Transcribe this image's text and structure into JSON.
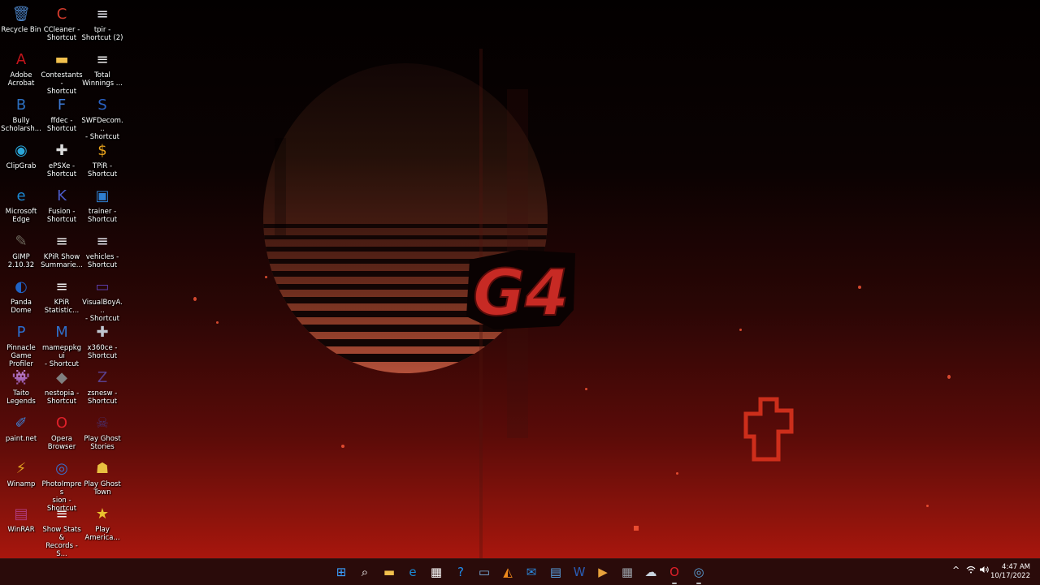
{
  "desktop": {
    "icons": [
      {
        "label": "Recycle Bin",
        "icon": "recycle-bin-icon",
        "glyph": "🗑",
        "color": "#4a7fc0"
      },
      {
        "label": "CCleaner -\nShortcut",
        "icon": "ccleaner-icon",
        "glyph": "C",
        "color": "#d33a2c"
      },
      {
        "label": "tpir -\nShortcut (2)",
        "icon": "document-icon",
        "glyph": "≡",
        "color": "#e8e8f0"
      },
      {
        "label": "Adobe\nAcrobat",
        "icon": "adobe-acrobat-icon",
        "glyph": "A",
        "color": "#c4141b"
      },
      {
        "label": "Contestants -\nShortcut",
        "icon": "folder-icon",
        "glyph": "▬",
        "color": "#f2c14e"
      },
      {
        "label": "Total\nWinnings ...",
        "icon": "text-file-icon",
        "glyph": "≡",
        "color": "#f0f0f0"
      },
      {
        "label": "Bully\nScholarsh...",
        "icon": "bully-game-icon",
        "glyph": "B",
        "color": "#2c6fbf"
      },
      {
        "label": "ffdec -\nShortcut",
        "icon": "ffdec-icon",
        "glyph": "F",
        "color": "#3d7ad6"
      },
      {
        "label": "SWFDecom...\n- Shortcut",
        "icon": "swf-decompiler-icon",
        "glyph": "S",
        "color": "#2a62c4"
      },
      {
        "label": "ClipGrab",
        "icon": "clipgrab-icon",
        "glyph": "◉",
        "color": "#2aa6d9"
      },
      {
        "label": "ePSXe -\nShortcut",
        "icon": "gamepad-icon",
        "glyph": "✚",
        "color": "#dcdcdc"
      },
      {
        "label": "TPiR -\nShortcut",
        "icon": "tpir-game-icon",
        "glyph": "$",
        "color": "#e8a21c"
      },
      {
        "label": "Microsoft\nEdge",
        "icon": "edge-icon",
        "glyph": "e",
        "color": "#1b8ad4"
      },
      {
        "label": "Fusion -\nShortcut",
        "icon": "fusion-emulator-icon",
        "glyph": "K",
        "color": "#4b5bc8"
      },
      {
        "label": "trainer -\nShortcut",
        "icon": "trainer-icon",
        "glyph": "▣",
        "color": "#2f7fd0"
      },
      {
        "label": "GIMP 2.10.32",
        "icon": "gimp-icon",
        "glyph": "✎",
        "color": "#6e6a5e"
      },
      {
        "label": "KPiR Show\nSummarie...",
        "icon": "text-file-icon",
        "glyph": "≡",
        "color": "#f0f0f0"
      },
      {
        "label": "vehicles -\nShortcut",
        "icon": "document-icon",
        "glyph": "≡",
        "color": "#e8e8f0"
      },
      {
        "label": "Panda Dome",
        "icon": "panda-dome-icon",
        "glyph": "◐",
        "color": "#1f63c6"
      },
      {
        "label": "KPiR\nStatistic...",
        "icon": "text-file-icon",
        "glyph": "≡",
        "color": "#f0f0f0"
      },
      {
        "label": "VisualBoyA...\n- Shortcut",
        "icon": "visualboyadvance-icon",
        "glyph": "▭",
        "color": "#5a3ca8"
      },
      {
        "label": "Pinnacle\nGame Profiler",
        "icon": "pinnacle-icon",
        "glyph": "P",
        "color": "#2b6fd1"
      },
      {
        "label": "mameppkgui\n- Shortcut",
        "icon": "mame-icon",
        "glyph": "M",
        "color": "#2f6fc9"
      },
      {
        "label": "x360ce -\nShortcut",
        "icon": "controller-icon",
        "glyph": "✚",
        "color": "#bfc6cf"
      },
      {
        "label": "Taito Legends",
        "icon": "space-invader-icon",
        "glyph": "👾",
        "color": "#ffffff"
      },
      {
        "label": "nestopia -\nShortcut",
        "icon": "nestopia-icon",
        "glyph": "◆",
        "color": "#808080"
      },
      {
        "label": "zsnesw -\nShortcut",
        "icon": "zsnes-icon",
        "glyph": "Z",
        "color": "#5a3f8c"
      },
      {
        "label": "paint.net",
        "icon": "paintnet-icon",
        "glyph": "✐",
        "color": "#3f83d8"
      },
      {
        "label": "Opera\nBrowser",
        "icon": "opera-icon",
        "glyph": "O",
        "color": "#e0202a"
      },
      {
        "label": "Play Ghost\nStories",
        "icon": "ghost-stories-icon",
        "glyph": "☠",
        "color": "#4a2e6a"
      },
      {
        "label": "Winamp",
        "icon": "winamp-icon",
        "glyph": "⚡",
        "color": "#e2a320"
      },
      {
        "label": "PhotoImpres\nsion -\nShortcut",
        "icon": "photoimpression-icon",
        "glyph": "◎",
        "color": "#3b6ec9"
      },
      {
        "label": "Play Ghost\nTown",
        "icon": "ghost-town-icon",
        "glyph": "☗",
        "color": "#e8c040"
      },
      {
        "label": "WinRAR",
        "icon": "winrar-icon",
        "glyph": "▤",
        "color": "#b03a7a"
      },
      {
        "label": "Show Stats &\nRecords - S...",
        "icon": "text-file-icon",
        "glyph": "≡",
        "color": "#f0f0f0"
      },
      {
        "label": "Play\nAmerica...",
        "icon": "star-icon",
        "glyph": "★",
        "color": "#e9c12e"
      }
    ],
    "wallpaper_logo": "G4"
  },
  "taskbar": {
    "items": [
      {
        "name": "start-button",
        "icon": "windows-logo-icon",
        "glyph": "⊞",
        "color": "#3aa0ff",
        "running": false
      },
      {
        "name": "search-button",
        "icon": "search-icon",
        "glyph": "⌕",
        "color": "#ffffff",
        "running": false
      },
      {
        "name": "file-explorer-button",
        "icon": "folder-icon",
        "glyph": "▬",
        "color": "#f2c14e",
        "running": false
      },
      {
        "name": "edge-button",
        "icon": "edge-icon",
        "glyph": "e",
        "color": "#1b8ad4",
        "running": false
      },
      {
        "name": "store-button",
        "icon": "store-icon",
        "glyph": "▦",
        "color": "#ffffff",
        "running": false
      },
      {
        "name": "help-button",
        "icon": "help-icon",
        "glyph": "?",
        "color": "#1f8ef0",
        "running": false
      },
      {
        "name": "remote-desktop-button",
        "icon": "remote-desktop-icon",
        "glyph": "▭",
        "color": "#7ab0e0",
        "running": false
      },
      {
        "name": "vlc-button",
        "icon": "vlc-icon",
        "glyph": "◭",
        "color": "#f08a1c",
        "running": false
      },
      {
        "name": "mail-button",
        "icon": "mail-icon",
        "glyph": "✉",
        "color": "#2b8be0",
        "running": false
      },
      {
        "name": "notepad-button",
        "icon": "notepad-icon",
        "glyph": "▤",
        "color": "#5aa5e8",
        "running": false
      },
      {
        "name": "word-button",
        "icon": "word-icon",
        "glyph": "W",
        "color": "#2a5db5",
        "running": false
      },
      {
        "name": "media-player-button",
        "icon": "media-player-icon",
        "glyph": "▶",
        "color": "#e8a23c",
        "running": false
      },
      {
        "name": "calculator-button",
        "icon": "calculator-icon",
        "glyph": "▦",
        "color": "#9aa0a8",
        "running": false
      },
      {
        "name": "cloud-app-button",
        "icon": "cloud-icon",
        "glyph": "☁",
        "color": "#c9d3de",
        "running": false
      },
      {
        "name": "opera-button",
        "icon": "opera-icon",
        "glyph": "O",
        "color": "#e0202a",
        "running": true
      },
      {
        "name": "photoimpression-button",
        "icon": "photoimpression-icon",
        "glyph": "◎",
        "color": "#5aa0d8",
        "running": true
      }
    ],
    "tray": {
      "chevron": "^",
      "wifi": "wifi-icon",
      "volume": "volume-icon"
    },
    "clock": {
      "time": "4:47 AM",
      "date": "10/17/2022"
    }
  }
}
